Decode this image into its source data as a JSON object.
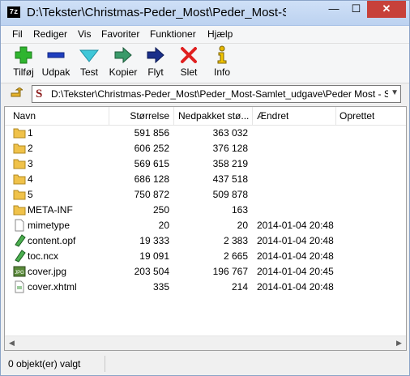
{
  "window": {
    "title": "D:\\Tekster\\Christmas-Peder_Most\\Peder_Most-Samlet_udgave\\Peder Most - S",
    "app_icon_text": "7z",
    "minimize_glyph": "—",
    "maximize_glyph": "☐",
    "close_glyph": "✕"
  },
  "menu": [
    "Fil",
    "Rediger",
    "Vis",
    "Favoriter",
    "Funktioner",
    "Hjælp"
  ],
  "toolbar": {
    "add": "Tilføj",
    "extract": "Udpak",
    "test": "Test",
    "copy": "Kopier",
    "move": "Flyt",
    "delete": "Slet",
    "info": "Info"
  },
  "pathbar": {
    "path": "D:\\Tekster\\Christmas-Peder_Most\\Peder_Most-Samlet_udgave\\Peder Most - S",
    "path_icon": "S"
  },
  "columns": {
    "name": "Navn",
    "size": "Størrelse",
    "packed": "Nedpakket stø...",
    "modified": "Ændret",
    "created": "Oprettet"
  },
  "files": [
    {
      "name": "1",
      "size": "591 856",
      "packed": "363 032",
      "modified": ""
    },
    {
      "name": "2",
      "size": "606 252",
      "packed": "376 128",
      "modified": ""
    },
    {
      "name": "3",
      "size": "569 615",
      "packed": "358 219",
      "modified": ""
    },
    {
      "name": "4",
      "size": "686 128",
      "packed": "437 518",
      "modified": ""
    },
    {
      "name": "5",
      "size": "750 872",
      "packed": "509 878",
      "modified": ""
    },
    {
      "name": "META-INF",
      "size": "250",
      "packed": "163",
      "modified": ""
    },
    {
      "name": "mimetype",
      "size": "20",
      "packed": "20",
      "modified": "2014-01-04 20:48"
    },
    {
      "name": "content.opf",
      "size": "19 333",
      "packed": "2 383",
      "modified": "2014-01-04 20:48"
    },
    {
      "name": "toc.ncx",
      "size": "19 091",
      "packed": "2 665",
      "modified": "2014-01-04 20:48"
    },
    {
      "name": "cover.jpg",
      "size": "203 504",
      "packed": "196 767",
      "modified": "2014-01-04 20:45"
    },
    {
      "name": "cover.xhtml",
      "size": "335",
      "packed": "214",
      "modified": "2014-01-04 20:48"
    }
  ],
  "status": {
    "selection": "0 objekt(er) valgt"
  }
}
